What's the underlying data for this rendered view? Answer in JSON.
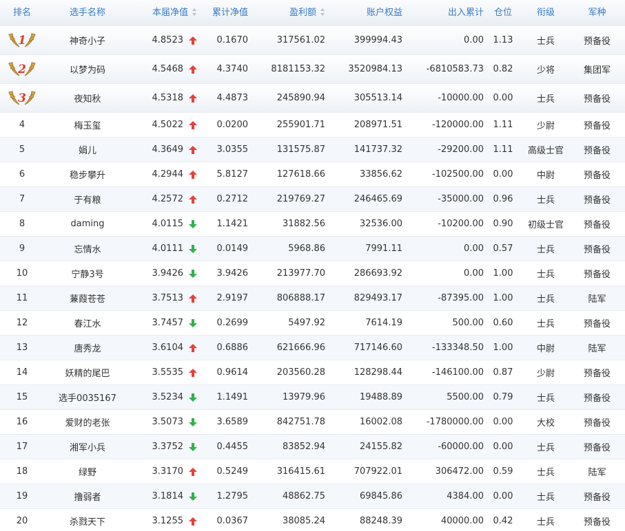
{
  "columns": {
    "rank": "排名",
    "name": "选手名称",
    "nav": "本届净值",
    "cum_nav": "累计净值",
    "profit": "盈利额",
    "equity": "账户权益",
    "inout": "出入累计",
    "position": "仓位",
    "title": "衔级",
    "service": "军种"
  },
  "colors": {
    "header_text": "#3b7cc4",
    "up_arrow": "#e8403c",
    "down_arrow": "#2fb24c",
    "medal_gold": "#d6a64a"
  },
  "rows": [
    {
      "rank": "1",
      "medal": true,
      "name": "神奇小子",
      "nav": "4.8523",
      "trend": "up",
      "cum_nav": "0.1670",
      "profit": "317561.02",
      "equity": "399994.43",
      "inout": "0.00",
      "position": "1.13",
      "title": "士兵",
      "service": "预备役"
    },
    {
      "rank": "2",
      "medal": true,
      "name": "以梦为码",
      "nav": "4.5468",
      "trend": "up",
      "cum_nav": "4.3740",
      "profit": "8181153.32",
      "equity": "3520984.13",
      "inout": "-6810583.73",
      "position": "0.82",
      "title": "少将",
      "service": "集团军"
    },
    {
      "rank": "3",
      "medal": true,
      "name": "夜知秋",
      "nav": "4.5318",
      "trend": "up",
      "cum_nav": "4.4873",
      "profit": "245890.94",
      "equity": "305513.14",
      "inout": "-10000.00",
      "position": "0.00",
      "title": "士兵",
      "service": "预备役"
    },
    {
      "rank": "4",
      "medal": false,
      "name": "梅玉玺",
      "nav": "4.5022",
      "trend": "up",
      "cum_nav": "0.0200",
      "profit": "255901.71",
      "equity": "208971.51",
      "inout": "-120000.00",
      "position": "1.11",
      "title": "少尉",
      "service": "预备役"
    },
    {
      "rank": "5",
      "medal": false,
      "name": "娟儿",
      "nav": "4.3649",
      "trend": "up",
      "cum_nav": "3.0355",
      "profit": "131575.87",
      "equity": "141737.32",
      "inout": "-29200.00",
      "position": "1.11",
      "title": "高级士官",
      "service": "预备役"
    },
    {
      "rank": "6",
      "medal": false,
      "name": "稳步攀升",
      "nav": "4.2944",
      "trend": "up",
      "cum_nav": "5.8127",
      "profit": "127618.66",
      "equity": "33856.62",
      "inout": "-102500.00",
      "position": "0.00",
      "title": "中尉",
      "service": "预备役"
    },
    {
      "rank": "7",
      "medal": false,
      "name": "于有粮",
      "nav": "4.2572",
      "trend": "up",
      "cum_nav": "0.2712",
      "profit": "219769.27",
      "equity": "246465.69",
      "inout": "-35000.00",
      "position": "0.96",
      "title": "士兵",
      "service": "预备役"
    },
    {
      "rank": "8",
      "medal": false,
      "name": "daming",
      "nav": "4.0115",
      "trend": "down",
      "cum_nav": "1.1421",
      "profit": "31882.56",
      "equity": "32536.00",
      "inout": "-10200.00",
      "position": "0.90",
      "title": "初级士官",
      "service": "预备役"
    },
    {
      "rank": "9",
      "medal": false,
      "name": "忘情水",
      "nav": "4.0111",
      "trend": "down",
      "cum_nav": "0.0149",
      "profit": "5968.86",
      "equity": "7991.11",
      "inout": "0.00",
      "position": "0.57",
      "title": "士兵",
      "service": "预备役"
    },
    {
      "rank": "10",
      "medal": false,
      "name": "宁静3号",
      "nav": "3.9426",
      "trend": "down",
      "cum_nav": "3.9426",
      "profit": "213977.70",
      "equity": "286693.92",
      "inout": "0.00",
      "position": "1.00",
      "title": "士兵",
      "service": "预备役"
    },
    {
      "rank": "11",
      "medal": false,
      "name": "蒹葭苍苍",
      "nav": "3.7513",
      "trend": "up",
      "cum_nav": "2.9197",
      "profit": "806888.17",
      "equity": "829493.17",
      "inout": "-87395.00",
      "position": "1.00",
      "title": "士兵",
      "service": "陆军"
    },
    {
      "rank": "12",
      "medal": false,
      "name": "春江水",
      "nav": "3.7457",
      "trend": "down",
      "cum_nav": "0.2699",
      "profit": "5497.92",
      "equity": "7614.19",
      "inout": "500.00",
      "position": "0.60",
      "title": "士兵",
      "service": "预备役"
    },
    {
      "rank": "13",
      "medal": false,
      "name": "唐秀龙",
      "nav": "3.6104",
      "trend": "up",
      "cum_nav": "0.6886",
      "profit": "621666.96",
      "equity": "717146.60",
      "inout": "-133348.50",
      "position": "1.00",
      "title": "中尉",
      "service": "陆军"
    },
    {
      "rank": "14",
      "medal": false,
      "name": "妖精的尾巴",
      "nav": "3.5535",
      "trend": "up",
      "cum_nav": "0.9614",
      "profit": "203560.28",
      "equity": "128298.44",
      "inout": "-146100.00",
      "position": "0.87",
      "title": "少尉",
      "service": "预备役"
    },
    {
      "rank": "15",
      "medal": false,
      "name": "选手0035167",
      "nav": "3.5234",
      "trend": "down",
      "cum_nav": "1.1491",
      "profit": "13979.96",
      "equity": "19488.89",
      "inout": "5500.00",
      "position": "0.79",
      "title": "士兵",
      "service": "预备役"
    },
    {
      "rank": "16",
      "medal": false,
      "name": "爱财的老张",
      "nav": "3.5073",
      "trend": "down",
      "cum_nav": "3.6589",
      "profit": "842751.78",
      "equity": "16002.08",
      "inout": "-1780000.00",
      "position": "0.00",
      "title": "大校",
      "service": "预备役"
    },
    {
      "rank": "17",
      "medal": false,
      "name": "湘军小兵",
      "nav": "3.3752",
      "trend": "down",
      "cum_nav": "0.4455",
      "profit": "83852.94",
      "equity": "24155.82",
      "inout": "-60000.00",
      "position": "0.00",
      "title": "士兵",
      "service": "预备役"
    },
    {
      "rank": "18",
      "medal": false,
      "name": "绿野",
      "nav": "3.3170",
      "trend": "up",
      "cum_nav": "0.5249",
      "profit": "316415.61",
      "equity": "707922.01",
      "inout": "306472.00",
      "position": "0.59",
      "title": "士兵",
      "service": "陆军"
    },
    {
      "rank": "19",
      "medal": false,
      "name": "撸弱者",
      "nav": "3.1814",
      "trend": "down",
      "cum_nav": "1.2795",
      "profit": "48862.75",
      "equity": "69845.86",
      "inout": "4384.00",
      "position": "0.00",
      "title": "士兵",
      "service": "预备役"
    },
    {
      "rank": "20",
      "medal": false,
      "name": "杀戮天下",
      "nav": "3.1255",
      "trend": "up",
      "cum_nav": "0.0367",
      "profit": "38085.24",
      "equity": "88248.39",
      "inout": "40000.00",
      "position": "0.42",
      "title": "士兵",
      "service": "预备役"
    }
  ]
}
